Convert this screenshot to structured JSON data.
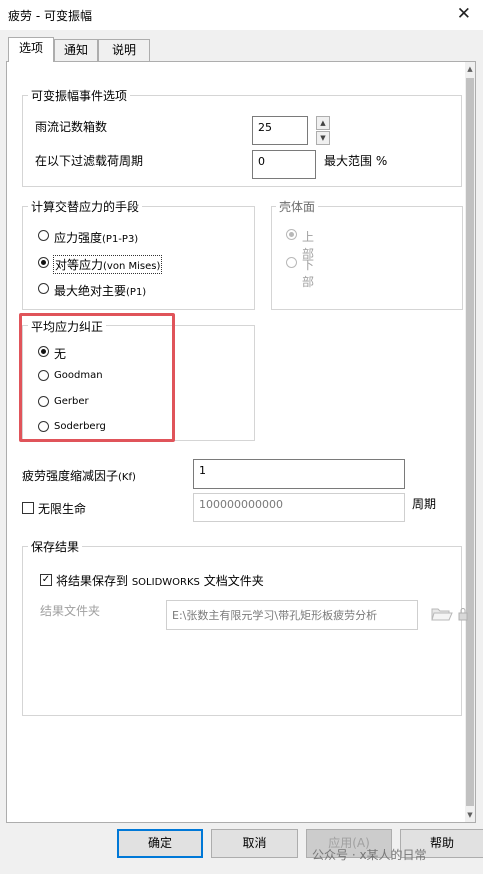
{
  "window": {
    "title": "疲劳 - 可变振幅",
    "close_glyph": "✕"
  },
  "tabs": [
    {
      "label": "选项",
      "active": true
    },
    {
      "label": "通知",
      "active": false
    },
    {
      "label": "说明",
      "active": false
    }
  ],
  "event_options": {
    "legend": "可变振幅事件选项",
    "rainflow_label": "雨流记数箱数",
    "rainflow_value": "25",
    "filter_label": "在以下过滤载荷周期",
    "filter_value": "0",
    "filter_suffix": "最大范围 %"
  },
  "alternating_stress": {
    "legend": "计算交替应力的手段",
    "options": [
      {
        "main": "应力强度",
        "suffix": "(P1-P3)",
        "selected": false
      },
      {
        "main": "对等应力",
        "suffix": "(von Mises)",
        "selected": true
      },
      {
        "main": "最大绝对主要",
        "suffix": "(P1)",
        "selected": false
      }
    ]
  },
  "shell_face": {
    "legend": "壳体面",
    "options": [
      {
        "label": "上部",
        "selected": true
      },
      {
        "label": "下部",
        "selected": false
      }
    ]
  },
  "mean_stress": {
    "legend": "平均应力纠正",
    "options": [
      {
        "label": "无",
        "selected": true
      },
      {
        "label": "Goodman",
        "selected": false
      },
      {
        "label": "Gerber",
        "selected": false
      },
      {
        "label": "Soderberg",
        "selected": false
      }
    ]
  },
  "fatigue_factor": {
    "label": "疲劳强度缩减因子",
    "suffix": "(Kf)",
    "value": "1"
  },
  "infinite_life": {
    "label": "无限生命",
    "checked": false,
    "value": "100000000000",
    "unit": "周期"
  },
  "save_results": {
    "legend": "保存结果",
    "checkbox_main": "将结果保存到 ",
    "checkbox_brand": "SOLIDWORKS",
    "checkbox_tail": " 文档文件夹",
    "checked": true,
    "folder_label": "结果文件夹",
    "folder_value": "E:\\张数主有限元学习\\带孔矩形板疲劳分析"
  },
  "buttons": {
    "ok": "确定",
    "cancel": "取消",
    "apply": "应用(A)",
    "help": "帮助"
  },
  "watermark": "公众号 · x某人的日常",
  "icons": {
    "close": "close-icon",
    "spin_up": "spin-up-icon",
    "spin_down": "spin-down-icon",
    "folder": "folder-open-icon"
  }
}
